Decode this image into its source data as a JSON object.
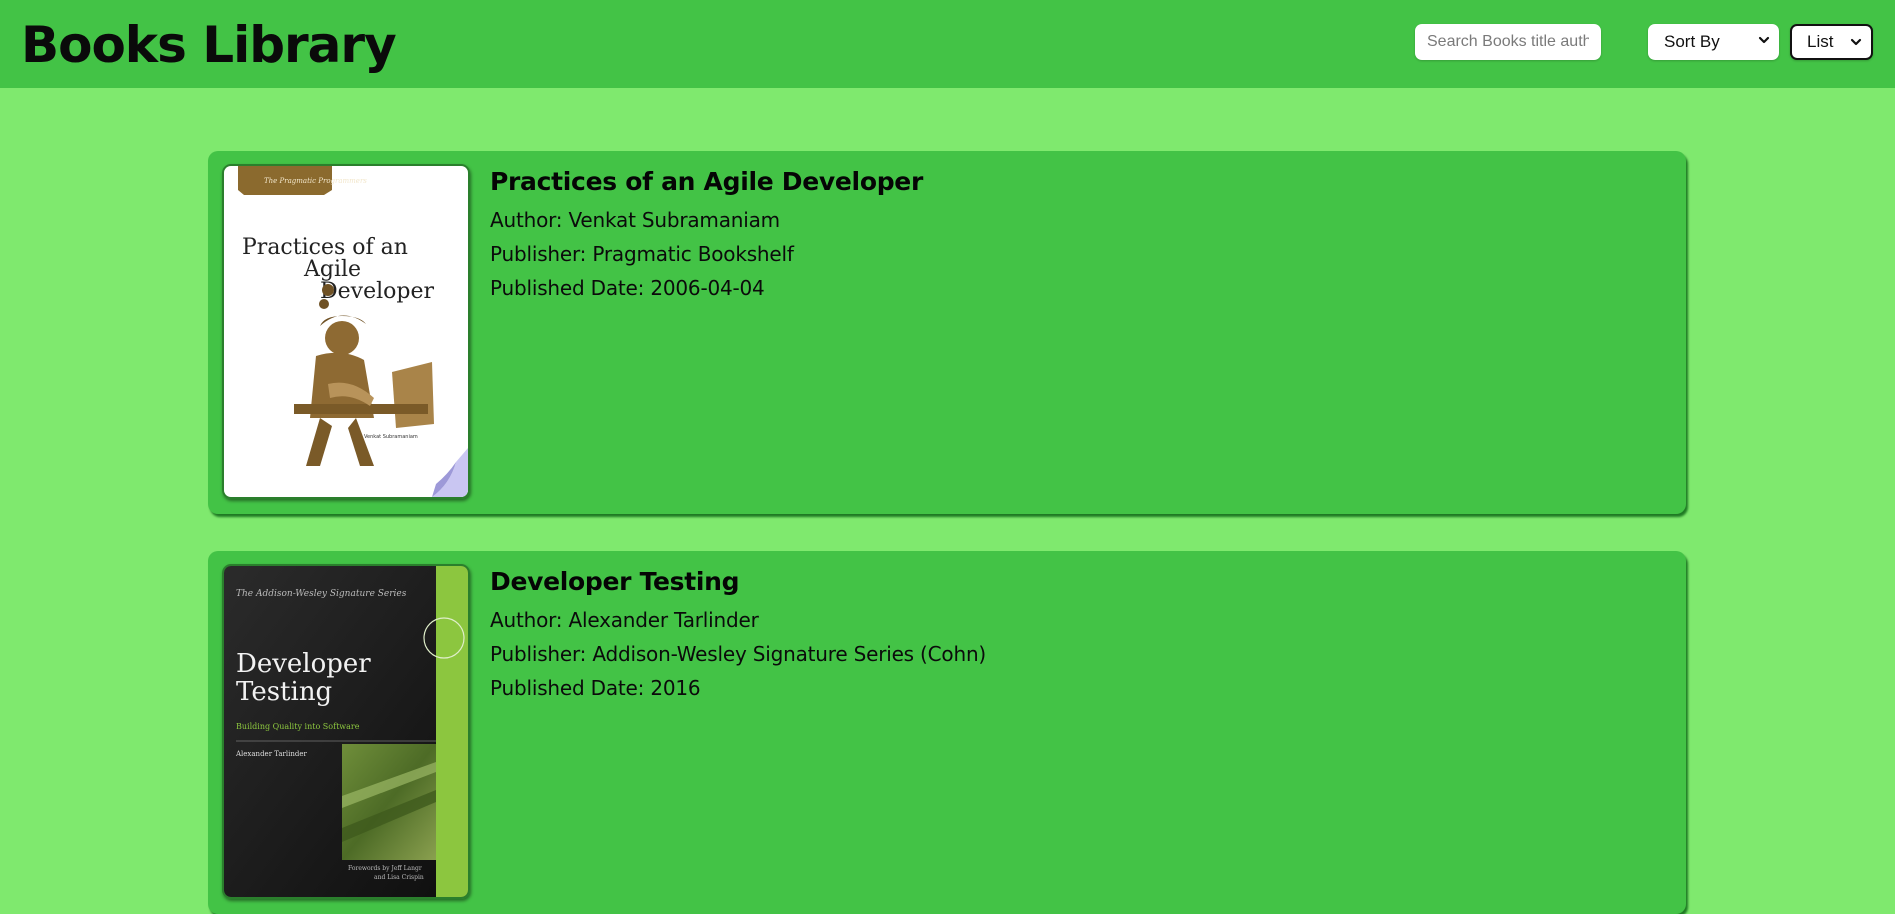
{
  "app": {
    "title": "Books Library"
  },
  "controls": {
    "search_placeholder": "Search Books title auther",
    "sort_label": "Sort By",
    "view_label": "List"
  },
  "books": [
    {
      "title": "Practices of an Agile Developer",
      "author": "Author: Venkat Subramaniam",
      "publisher": "Publisher: Pragmatic Bookshelf",
      "published": "Published Date: 2006-04-04",
      "cover": {
        "series": "The Pragmatic Programmers",
        "title_lines": [
          "Practices of an",
          "Agile",
          "Developer"
        ],
        "byline": "Venkat Subramaniam"
      }
    },
    {
      "title": "Developer Testing",
      "author": "Author: Alexander Tarlinder",
      "publisher": "Publisher: Addison-Wesley Signature Series (Cohn)",
      "published": "Published Date: 2016",
      "cover": {
        "series": "The Addison-Wesley Signature Series",
        "title_lines": [
          "Developer",
          "Testing"
        ],
        "subtitle": "Building Quality into Software",
        "byline": "Alexander Tarlinder",
        "foreword": [
          "Forewords by Jeff Langr",
          "and Lisa Crispin"
        ]
      }
    }
  ],
  "colors": {
    "page_background": "#7fe96e",
    "header_background": "#43c346",
    "card_background": "#43c346"
  }
}
